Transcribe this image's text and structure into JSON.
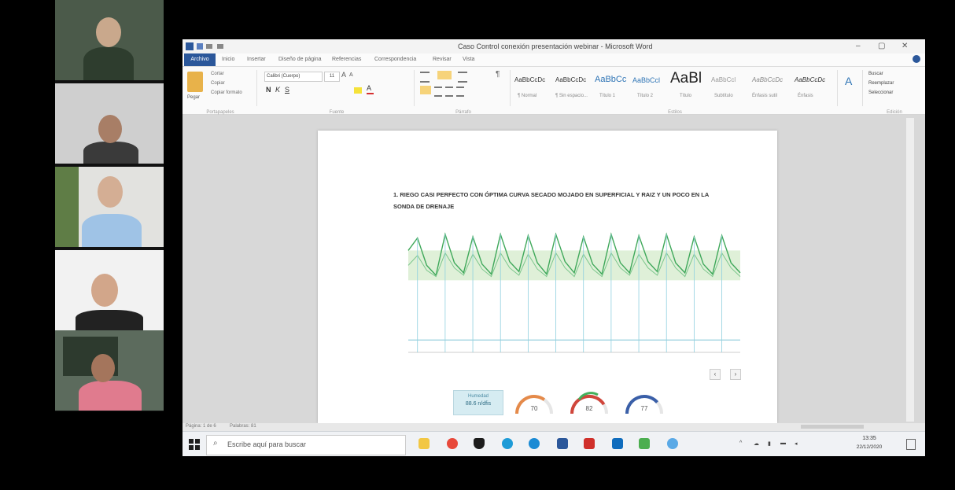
{
  "app": {
    "window_title": "Caso Control conexión presentación webinar - Microsoft Word",
    "ribbon_tabs": [
      "Archivo",
      "Inicio",
      "Insertar",
      "Diseño de página",
      "Referencias",
      "Correspondencia",
      "Revisar",
      "Vista"
    ],
    "ribbon_groups": [
      "Portapapeles",
      "Fuente",
      "Párrafo",
      "Estilos",
      "Edición"
    ],
    "clipboard": {
      "paste": "Pegar",
      "cut": "Cortar",
      "copy": "Copiar",
      "format": "Copiar formato"
    },
    "font": {
      "name": "Calibri (Cuerpo)",
      "size": "11"
    },
    "styles": [
      {
        "sample": "AaBbCcDc",
        "label": "¶ Normal"
      },
      {
        "sample": "AaBbCcDc",
        "label": "¶ Sin espacio..."
      },
      {
        "sample": "AaBbCc",
        "label": "Título 1"
      },
      {
        "sample": "AaBbCcl",
        "label": "Título 2"
      },
      {
        "sample": "AaBl",
        "label": "Título"
      },
      {
        "sample": "AaBbCcl",
        "label": "Subtítulo"
      },
      {
        "sample": "AaBbCcDc",
        "label": "Énfasis sutil"
      },
      {
        "sample": "AaBbCcDc",
        "label": "Énfasis"
      }
    ],
    "editing": {
      "find": "Buscar",
      "replace": "Reemplazar",
      "select": "Seleccionar"
    }
  },
  "document": {
    "heading": "1.   RIEGO CASI PERFECTO CON ÓPTIMA CURVA SECADO MOJADO EN SUPERFICIAL Y RAIZ Y UN POCO EN LA SONDA DE DRENAJE",
    "card": {
      "title": "Humedad",
      "value": "88.6 n/dfis"
    },
    "gauges": [
      {
        "value": "70",
        "color": "#e58a4a"
      },
      {
        "value": "82",
        "color": "#d0463b"
      },
      {
        "value": "77",
        "color": "#3a5fa8"
      }
    ]
  },
  "chart_data": {
    "type": "line",
    "series": [
      {
        "color": "#3fa85a",
        "values": [
          82,
          92,
          70,
          62,
          95,
          72,
          64,
          93,
          71,
          63,
          95,
          73,
          65,
          94,
          72,
          63,
          95,
          73,
          64,
          93,
          71,
          63,
          95,
          72,
          64,
          94,
          73,
          65,
          95,
          72,
          64,
          93,
          71,
          63,
          94,
          72,
          64
        ]
      },
      {
        "color": "#7cc68c",
        "values": [
          70,
          78,
          66,
          61,
          80,
          68,
          62,
          79,
          67,
          61,
          80,
          68,
          62,
          79,
          67,
          61,
          80,
          68,
          61,
          79,
          67,
          61,
          80,
          68,
          62,
          79,
          68,
          62,
          80,
          68,
          61,
          79,
          67,
          61,
          80,
          68,
          61
        ]
      },
      {
        "color": "#7fc4d6",
        "values": [
          10,
          10,
          10,
          10,
          10,
          10,
          10,
          10,
          10,
          10,
          10,
          10,
          10,
          10,
          10,
          10,
          10,
          10,
          10,
          10,
          10,
          10,
          10,
          10,
          10,
          10,
          10,
          10,
          10,
          10,
          10,
          10,
          10,
          10,
          10,
          10,
          10
        ]
      }
    ],
    "ylim": [
      0,
      100
    ],
    "band": [
      58,
      82
    ],
    "grid": false
  },
  "taskbar": {
    "search_placeholder": "Escribe aquí para buscar",
    "icons": [
      "file-explorer-icon",
      "chrome-icon",
      "shield-icon",
      "skype-icon",
      "edge-icon",
      "word-icon",
      "acrobat-icon",
      "outlook-icon",
      "excel-icon",
      "zoom-icon"
    ],
    "clock": {
      "time": "13:35",
      "date": "22/12/2020"
    }
  },
  "statusbar": {
    "page": "Página: 1 de 6",
    "words": "Palabras: 81"
  }
}
